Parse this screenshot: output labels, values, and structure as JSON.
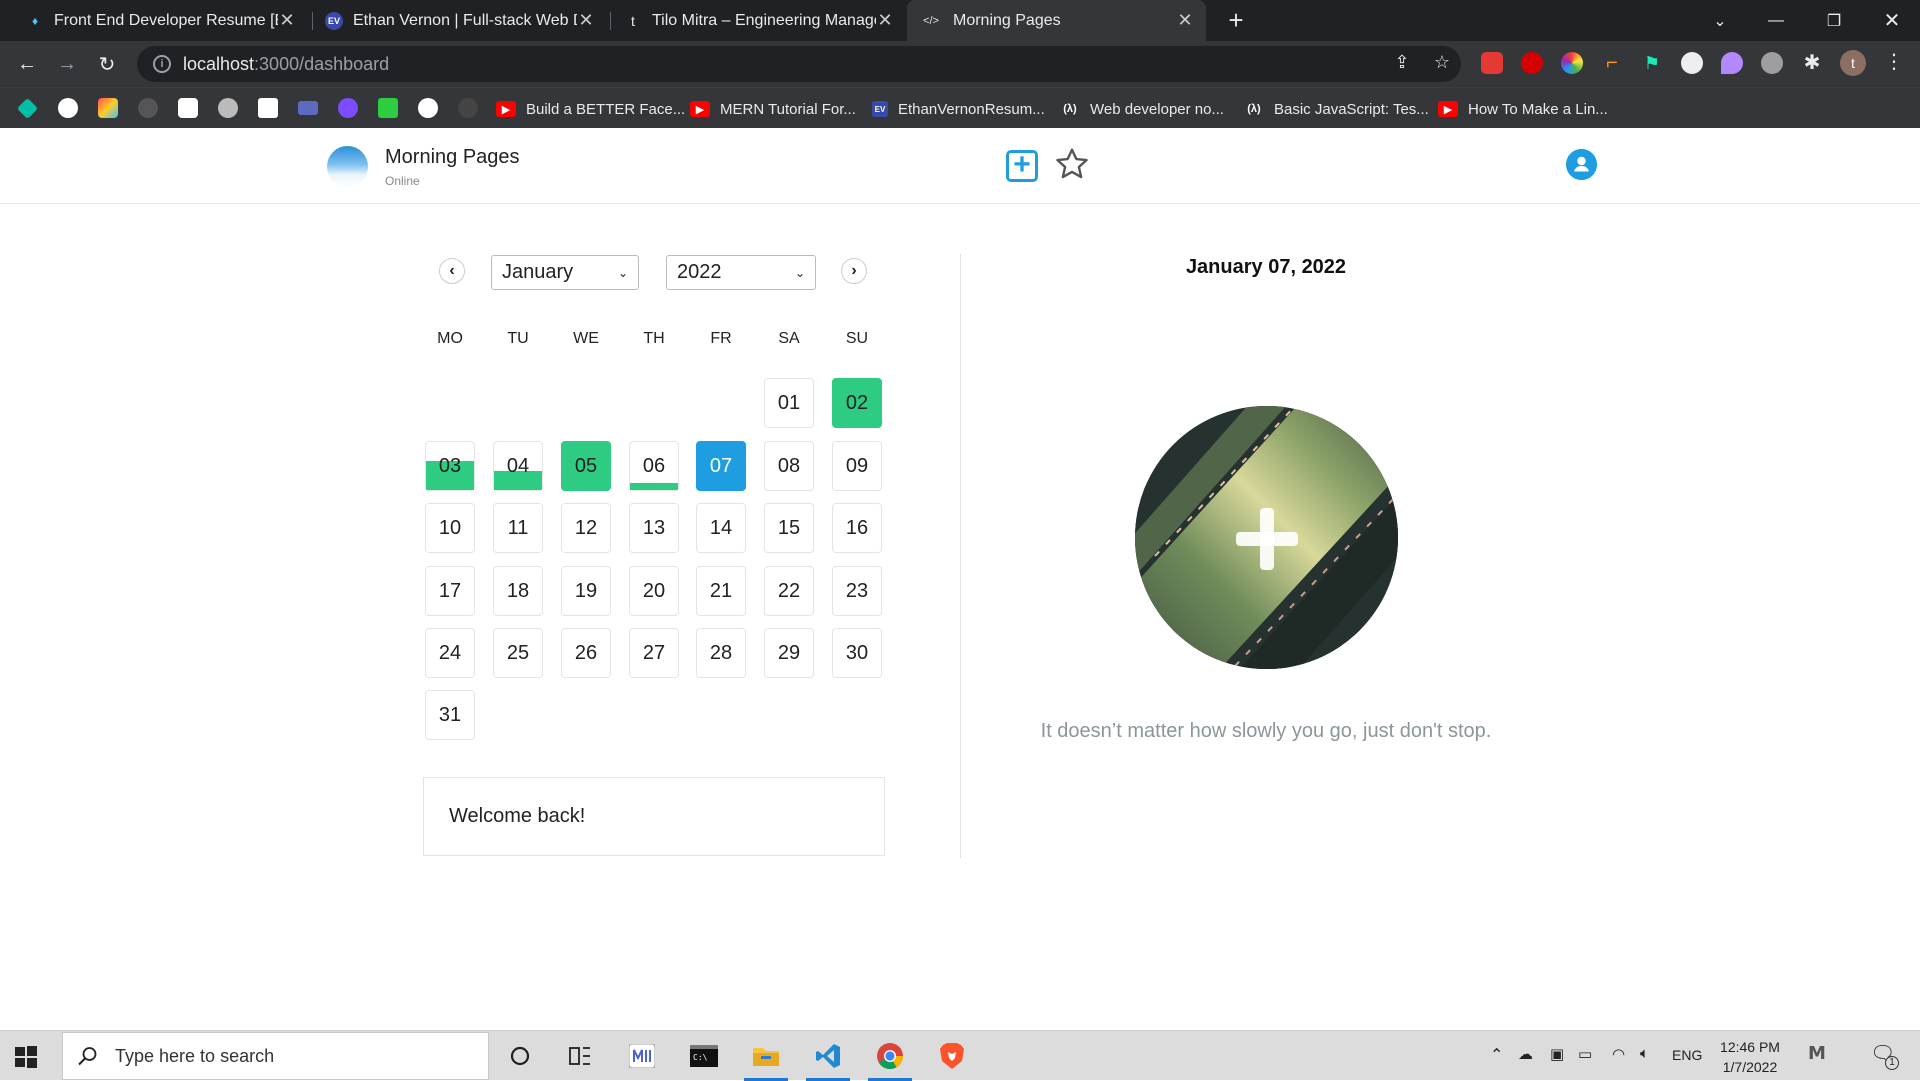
{
  "browser": {
    "tabs": [
      {
        "title": "Front End Developer Resume [Ex",
        "favicon": "♦",
        "active": false
      },
      {
        "title": "Ethan Vernon | Full-stack Web De",
        "favicon": "EV",
        "active": false
      },
      {
        "title": "Tilo Mitra – Engineering Manage",
        "favicon": "t",
        "active": false
      },
      {
        "title": "Morning Pages",
        "favicon": "</>",
        "active": true
      }
    ],
    "address": {
      "host": "localhost",
      "path": ":3000/dashboard"
    },
    "profile_initial": "t",
    "bookmarks": [
      {
        "label": "Build a BETTER Face...",
        "icon": "youtube"
      },
      {
        "label": "MERN Tutorial For...",
        "icon": "youtube"
      },
      {
        "label": "EthanVernonResum...",
        "icon": "ev"
      },
      {
        "label": "Web developer no...",
        "icon": "lambda"
      },
      {
        "label": "Basic JavaScript: Tes...",
        "icon": "lambda"
      },
      {
        "label": "How To Make a Lin...",
        "icon": "youtube"
      }
    ]
  },
  "app": {
    "brand": "Morning Pages",
    "status": "Online",
    "calendar": {
      "month": "January",
      "year": "2022",
      "weekdays": [
        "MO",
        "TU",
        "WE",
        "TH",
        "FR",
        "SA",
        "SU"
      ],
      "days": [
        {
          "label": "01",
          "state": "none",
          "fill": 0
        },
        {
          "label": "02",
          "state": "done",
          "fill": 1
        },
        {
          "label": "03",
          "state": "partial",
          "fill": 0.6
        },
        {
          "label": "04",
          "state": "partial",
          "fill": 0.4
        },
        {
          "label": "05",
          "state": "done",
          "fill": 1
        },
        {
          "label": "06",
          "state": "partial",
          "fill": 0.15
        },
        {
          "label": "07",
          "state": "today",
          "fill": 0
        },
        {
          "label": "08",
          "state": "none",
          "fill": 0
        },
        {
          "label": "09",
          "state": "none",
          "fill": 0
        },
        {
          "label": "10",
          "state": "none",
          "fill": 0
        },
        {
          "label": "11",
          "state": "none",
          "fill": 0
        },
        {
          "label": "12",
          "state": "none",
          "fill": 0
        },
        {
          "label": "13",
          "state": "none",
          "fill": 0
        },
        {
          "label": "14",
          "state": "none",
          "fill": 0
        },
        {
          "label": "15",
          "state": "none",
          "fill": 0
        },
        {
          "label": "16",
          "state": "none",
          "fill": 0
        },
        {
          "label": "17",
          "state": "none",
          "fill": 0
        },
        {
          "label": "18",
          "state": "none",
          "fill": 0
        },
        {
          "label": "19",
          "state": "none",
          "fill": 0
        },
        {
          "label": "20",
          "state": "none",
          "fill": 0
        },
        {
          "label": "21",
          "state": "none",
          "fill": 0
        },
        {
          "label": "22",
          "state": "none",
          "fill": 0
        },
        {
          "label": "23",
          "state": "none",
          "fill": 0
        },
        {
          "label": "24",
          "state": "none",
          "fill": 0
        },
        {
          "label": "25",
          "state": "none",
          "fill": 0
        },
        {
          "label": "26",
          "state": "none",
          "fill": 0
        },
        {
          "label": "27",
          "state": "none",
          "fill": 0
        },
        {
          "label": "28",
          "state": "none",
          "fill": 0
        },
        {
          "label": "29",
          "state": "none",
          "fill": 0
        },
        {
          "label": "30",
          "state": "none",
          "fill": 0
        },
        {
          "label": "31",
          "state": "none",
          "fill": 0
        }
      ],
      "first_weekday_index": 5
    },
    "welcome": "Welcome back!",
    "selected_date": "January 07, 2022",
    "quote": "It doesn’t matter how slowly you go, just don't stop.",
    "colors": {
      "accent": "#1e9ee0",
      "done": "#2ecc82"
    }
  },
  "taskbar": {
    "search_placeholder": "Type here to search",
    "language": "ENG",
    "time": "12:46 PM",
    "date": "1/7/2022",
    "notification_count": "1"
  }
}
